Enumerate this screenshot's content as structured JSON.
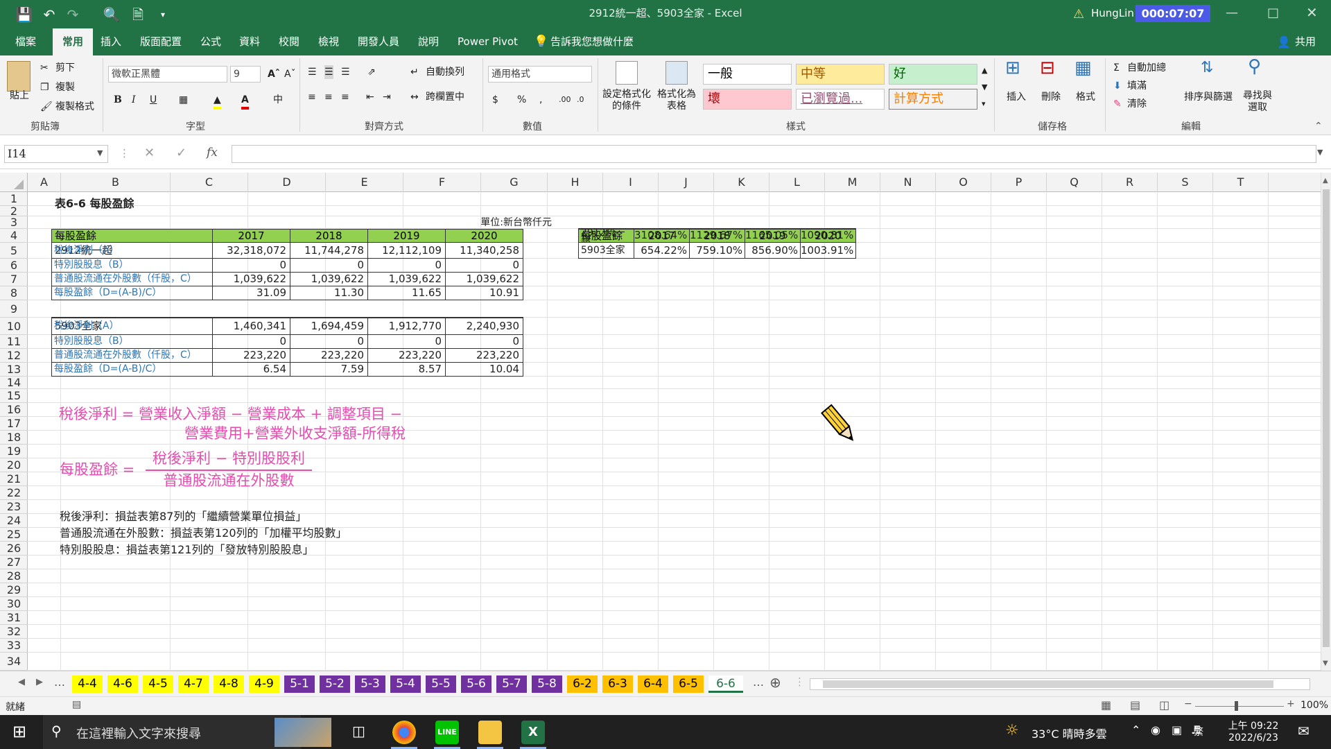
{
  "app": {
    "title": "2912統一超、5903全家 - Excel",
    "user": "HungLin",
    "overlay_badge": "000:07:07",
    "accent": "#217346"
  },
  "quick_access": {
    "save": "save-icon",
    "undo": "undo-icon",
    "redo": "redo-icon",
    "print_preview": "print-preview-icon",
    "new": "new-file-icon",
    "customize": "customize-icon"
  },
  "tabs": [
    "檔案",
    "常用",
    "插入",
    "版面配置",
    "公式",
    "資料",
    "校閱",
    "檢視",
    "開發人員",
    "說明",
    "Power Pivot"
  ],
  "active_tab": "常用",
  "tell_me": "告訴我您想做什麼",
  "share": "共用",
  "ribbon": {
    "clipboard": {
      "paste": "貼上",
      "cut": "剪下",
      "copy": "複製",
      "format_painter": "複製格式",
      "label": "剪貼簿"
    },
    "font": {
      "name": "微軟正黑體",
      "size": "9",
      "label": "字型",
      "bold": "B",
      "italic": "I",
      "underline": "U"
    },
    "alignment": {
      "wrap": "自動換列",
      "merge": "跨欄置中",
      "label": "對齊方式"
    },
    "number": {
      "format": "通用格式",
      "label": "數值",
      "currency": "$",
      "percent": "%",
      "comma": ","
    },
    "styles": {
      "conditional": "設定格式化的條件",
      "format_table": "格式化為表格",
      "normal": "一般",
      "neutral": "中等",
      "good": "好",
      "bad": "壞",
      "visited": "已瀏覽過...",
      "calc": "計算方式",
      "label": "樣式"
    },
    "cells": {
      "insert": "插入",
      "delete": "刪除",
      "format": "格式",
      "label": "儲存格"
    },
    "editing": {
      "autosum": "自動加總",
      "fill": "填滿",
      "clear": "清除",
      "sort": "排序與篩選",
      "find": "尋找與選取",
      "label": "編輯"
    }
  },
  "formula_bar": {
    "name_box": "I14",
    "fx": "fx",
    "value": ""
  },
  "columns": [
    "A",
    "B",
    "C",
    "D",
    "E",
    "F",
    "G",
    "H",
    "I",
    "J",
    "K",
    "L",
    "M",
    "N",
    "O",
    "P",
    "Q",
    "R",
    "S",
    "T"
  ],
  "rows": [
    "1",
    "2",
    "3",
    "4",
    "5",
    "6",
    "7",
    "8",
    "9",
    "10",
    "11",
    "12",
    "13",
    "14",
    "15",
    "16",
    "17",
    "18",
    "19",
    "20",
    "21",
    "22",
    "23",
    "24",
    "25",
    "26",
    "27",
    "28",
    "29",
    "30",
    "31",
    "32",
    "33",
    "34"
  ],
  "sheet": {
    "title": "表6-6 每股盈餘",
    "unit": "單位:新台幣仟元",
    "header": [
      "每股盈餘",
      "2017",
      "2018",
      "2019",
      "2020"
    ],
    "company1": "2912統一超",
    "company1_rows": [
      {
        "label": "稅後淨利（A）",
        "v": [
          "32,318,072",
          "11,744,278",
          "12,112,109",
          "11,340,258"
        ]
      },
      {
        "label": "特別股股息（B）",
        "v": [
          "0",
          "0",
          "0",
          "0"
        ]
      },
      {
        "label": "普通股流通在外股數（仟股，C）",
        "v": [
          "1,039,622",
          "1,039,622",
          "1,039,622",
          "1,039,622"
        ]
      },
      {
        "label": "每股盈餘（D=(A-B)/C）",
        "v": [
          "31.09",
          "11.30",
          "11.65",
          "10.91"
        ]
      }
    ],
    "company2": "5903全家",
    "company2_rows": [
      {
        "label": "稅後淨利（A）",
        "v": [
          "1,460,341",
          "1,694,459",
          "1,912,770",
          "2,240,930"
        ]
      },
      {
        "label": "特別股股息（B）",
        "v": [
          "0",
          "0",
          "0",
          "0"
        ]
      },
      {
        "label": "普通股流通在外股數（仟股，C）",
        "v": [
          "223,220",
          "223,220",
          "223,220",
          "223,220"
        ]
      },
      {
        "label": "每股盈餘（D=(A-B)/C）",
        "v": [
          "6.54",
          "7.59",
          "8.57",
          "10.04"
        ]
      }
    ],
    "growth": {
      "header": [
        "每股盈餘",
        "2017",
        "2018",
        "2019",
        "2020"
      ],
      "rows": [
        {
          "label": "2912統一超",
          "v": [
            "3108.64%",
            "1129.67%",
            "1165.05%",
            "1090.81%"
          ]
        },
        {
          "label": "5903全家",
          "v": [
            "654.22%",
            "759.10%",
            "856.90%",
            "1003.91%"
          ]
        }
      ]
    },
    "formula1_line1": "稅後淨利 = 營業收入淨額 − 營業成本 + 調整項目 −",
    "formula1_line2": "營業費用+營業外收支淨額-所得稅",
    "formula2_lhs": "每股盈餘 =",
    "formula2_num": "稅後淨利 − 特別股股利",
    "formula2_den": "普通股流通在外股數",
    "notes": [
      "稅後淨利：損益表第87列的「繼續營業單位損益」",
      "普通股流通在外股數：損益表第120列的「加權平均股數」",
      "特別股股息：損益表第121列的「發放特別股股息」"
    ]
  },
  "sheet_tabs": [
    {
      "name": "4-4",
      "color": "#ffff00",
      "text": "#000"
    },
    {
      "name": "4-6",
      "color": "#ffff00",
      "text": "#000"
    },
    {
      "name": "4-5",
      "color": "#ffff00",
      "text": "#000"
    },
    {
      "name": "4-7",
      "color": "#ffff00",
      "text": "#000"
    },
    {
      "name": "4-8",
      "color": "#ffff00",
      "text": "#000"
    },
    {
      "name": "4-9",
      "color": "#ffff00",
      "text": "#000"
    },
    {
      "name": "5-1",
      "color": "#7030a0",
      "text": "#fff"
    },
    {
      "name": "5-2",
      "color": "#7030a0",
      "text": "#fff"
    },
    {
      "name": "5-3",
      "color": "#7030a0",
      "text": "#fff"
    },
    {
      "name": "5-4",
      "color": "#7030a0",
      "text": "#fff"
    },
    {
      "name": "5-5",
      "color": "#7030a0",
      "text": "#fff"
    },
    {
      "name": "5-6",
      "color": "#7030a0",
      "text": "#fff"
    },
    {
      "name": "5-7",
      "color": "#7030a0",
      "text": "#fff"
    },
    {
      "name": "5-8",
      "color": "#7030a0",
      "text": "#fff"
    },
    {
      "name": "6-2",
      "color": "#ffc000",
      "text": "#000"
    },
    {
      "name": "6-3",
      "color": "#ffc000",
      "text": "#000"
    },
    {
      "name": "6-4",
      "color": "#ffc000",
      "text": "#000"
    },
    {
      "name": "6-5",
      "color": "#ffc000",
      "text": "#000"
    },
    {
      "name": "6-6",
      "color": "#ffffff",
      "text": "#217346"
    }
  ],
  "status": {
    "ready": "就緒",
    "zoom": "100%"
  },
  "taskbar": {
    "search": "在這裡輸入文字來搜尋",
    "weather": "33°C 晴時多雲",
    "ime": "繁",
    "time": "上午 09:22",
    "date": "2022/6/23"
  }
}
